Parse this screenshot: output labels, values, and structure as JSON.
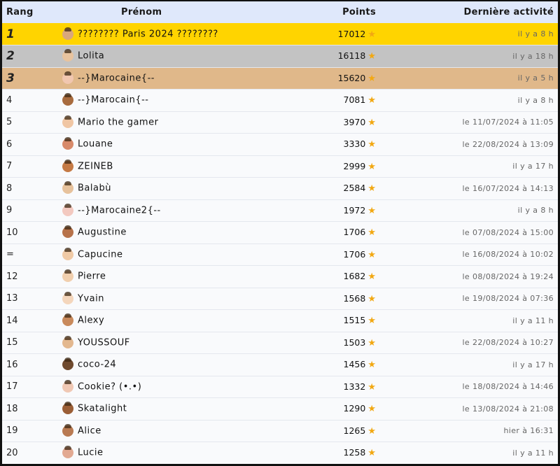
{
  "header": {
    "rank": "Rang",
    "name": "Prénom",
    "points": "Points",
    "last_activity": "Dernière activité"
  },
  "rows": [
    {
      "rank": "1",
      "name": "???????? Paris 2024 ????????",
      "points": "17012",
      "last": "il y a 8 h",
      "avatar_color": "#d9a77c"
    },
    {
      "rank": "2",
      "name": "Lolita",
      "points": "16118",
      "last": "il y a 18 h",
      "avatar_color": "#e8c39e"
    },
    {
      "rank": "3",
      "name": "--}Marocaine{--",
      "points": "15620",
      "last": "il y a 5 h",
      "avatar_color": "#f1c7b0"
    },
    {
      "rank": "4",
      "name": "--}Marocain{--",
      "points": "7081",
      "last": "il y a 8 h",
      "avatar_color": "#a86b3e"
    },
    {
      "rank": "5",
      "name": "Mario the gamer",
      "points": "3970",
      "last": "le 11/07/2024 à 11:05",
      "avatar_color": "#f0c6a4"
    },
    {
      "rank": "6",
      "name": "Louane",
      "points": "3330",
      "last": "le 22/08/2024 à 13:09",
      "avatar_color": "#d88a6a"
    },
    {
      "rank": "7",
      "name": "ZEINEB",
      "points": "2999",
      "last": "il y a 17 h",
      "avatar_color": "#c57a45"
    },
    {
      "rank": "8",
      "name": "Balabù",
      "points": "2584",
      "last": "le 16/07/2024 à 14:13",
      "avatar_color": "#e7c29c"
    },
    {
      "rank": "9",
      "name": "--}Marocaine2{--",
      "points": "1972",
      "last": "il y a 8 h",
      "avatar_color": "#f3c9c0"
    },
    {
      "rank": "10",
      "name": "Augustine",
      "points": "1706",
      "last": "le 07/08/2024 à 15:00",
      "avatar_color": "#b7724a"
    },
    {
      "rank": "=",
      "name": "Capucine",
      "points": "1706",
      "last": "le 16/08/2024 à 10:02",
      "avatar_color": "#f0caa6"
    },
    {
      "rank": "12",
      "name": "Pierre",
      "points": "1682",
      "last": "le 08/08/2024 à 19:24",
      "avatar_color": "#f1cfae"
    },
    {
      "rank": "13",
      "name": "Yvain",
      "points": "1568",
      "last": "le 19/08/2024 à 07:36",
      "avatar_color": "#f4d6bc"
    },
    {
      "rank": "14",
      "name": "Alexy",
      "points": "1515",
      "last": "il y a 11 h",
      "avatar_color": "#c98a5c"
    },
    {
      "rank": "15",
      "name": "YOUSSOUF",
      "points": "1503",
      "last": "le 22/08/2024 à 10:27",
      "avatar_color": "#e3b88f"
    },
    {
      "rank": "16",
      "name": "coco-24",
      "points": "1456",
      "last": "il y a 17 h",
      "avatar_color": "#6f4a2e"
    },
    {
      "rank": "17",
      "name": "Cookie? (•.•)",
      "points": "1332",
      "last": "le 18/08/2024 à 14:46",
      "avatar_color": "#f0c8b4"
    },
    {
      "rank": "18",
      "name": "Skatalight",
      "points": "1290",
      "last": "le 13/08/2024 à 21:08",
      "avatar_color": "#9b5e36"
    },
    {
      "rank": "19",
      "name": "Alice",
      "points": "1265",
      "last": "hier à 16:31",
      "avatar_color": "#b97a52"
    },
    {
      "rank": "20",
      "name": "Lucie",
      "points": "1258",
      "last": "il y a 11 h",
      "avatar_color": "#e2a992"
    }
  ],
  "icons": {
    "star": "star-icon",
    "avatar": "avatar-icon"
  },
  "colors": {
    "header_bg": "#dfe8fb",
    "gold": "#ffd400",
    "silver": "#c3c3c3",
    "bronze": "#e0b88a",
    "star": "#f2a812"
  }
}
